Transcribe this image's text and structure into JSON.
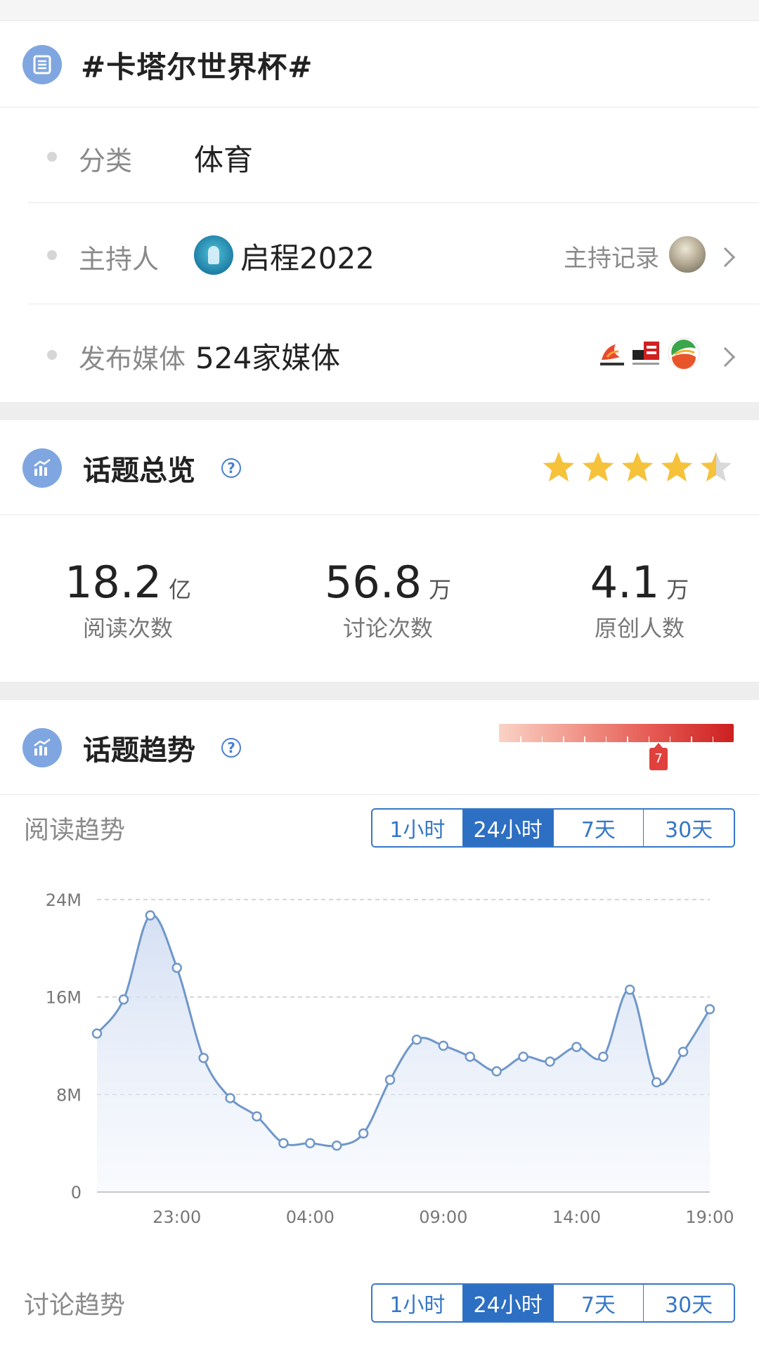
{
  "topic": {
    "title": "#卡塔尔世界杯#",
    "icon": "list-document-icon"
  },
  "info": {
    "category_label": "分类",
    "category_value": "体育",
    "host_label": "主持人",
    "host_name": "启程2022",
    "host_link": "主持记录",
    "media_label": "发布媒体",
    "media_value": "524家媒体"
  },
  "overview": {
    "title": "话题总览",
    "rating_stars": 4.5,
    "stats": [
      {
        "value": "18.2",
        "unit": "亿",
        "label": "阅读次数"
      },
      {
        "value": "56.8",
        "unit": "万",
        "label": "讨论次数"
      },
      {
        "value": "4.1",
        "unit": "万",
        "label": "原创人数"
      }
    ]
  },
  "trend": {
    "title": "话题趋势",
    "heat_level": "7",
    "heat_level_fraction": 0.68,
    "read_label": "阅读趋势",
    "discuss_label": "讨论趋势",
    "ranges": [
      "1小时",
      "24小时",
      "7天",
      "30天"
    ],
    "active_range": 1
  },
  "colors": {
    "accent": "#2d6fc2",
    "line": "#6f97c9",
    "star": "#f5c23a",
    "heat": "#cc1f20"
  },
  "chart_data": {
    "type": "area",
    "yticks": [
      "0",
      "8M",
      "16M",
      "24M"
    ],
    "ylim": [
      0,
      24
    ],
    "xticks": [
      "23:00",
      "04:00",
      "09:00",
      "14:00",
      "19:00"
    ],
    "xtick_positions": [
      3,
      8,
      13,
      18,
      23
    ],
    "x": [
      0,
      1,
      2,
      3,
      4,
      5,
      6,
      7,
      8,
      9,
      10,
      11,
      12,
      13,
      14,
      15,
      16,
      17,
      18,
      19,
      20,
      21,
      22,
      23
    ],
    "values": [
      13,
      15.8,
      22.7,
      18.4,
      11,
      7.7,
      6.2,
      4,
      4,
      3.8,
      4.8,
      9.2,
      12.5,
      12,
      11.1,
      9.9,
      11.1,
      10.7,
      11.9,
      11.1,
      16.6,
      9,
      11.5,
      15
    ]
  }
}
